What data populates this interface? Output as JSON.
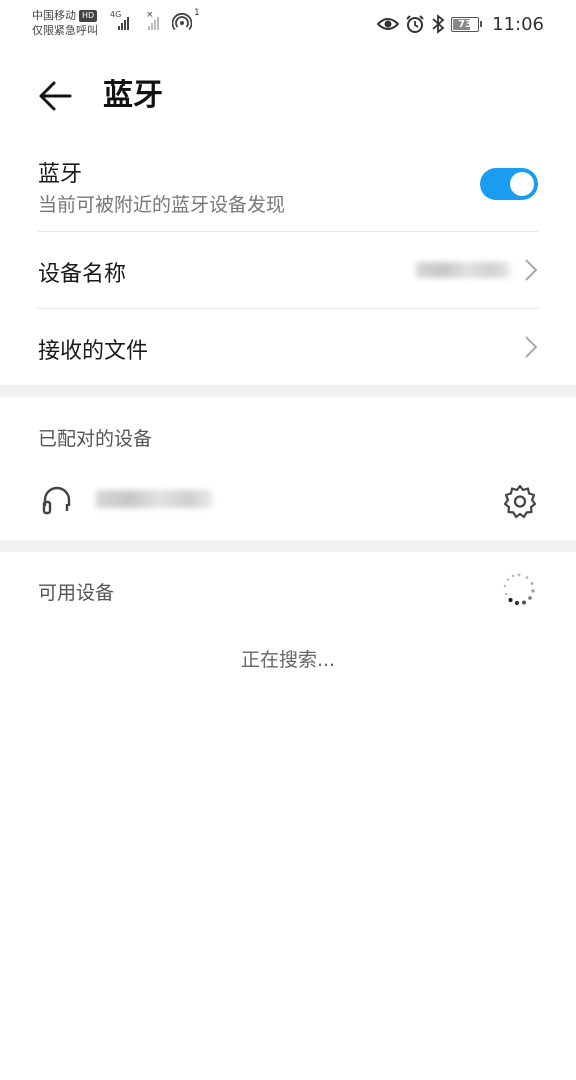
{
  "status_bar": {
    "carrier_line1": "中国移动",
    "hd_badge": "HD",
    "carrier_line2": "仅限紧急呼叫",
    "network_type": "4G",
    "hotspot_count": "1",
    "battery_level": "73",
    "battery_fraction": 0.73,
    "time": "11:06",
    "icons": [
      "signal-icon",
      "no-sim-icon",
      "hotspot-icon",
      "eye-comfort-icon",
      "alarm-icon",
      "bluetooth-icon",
      "battery-icon"
    ]
  },
  "header": {
    "title": "蓝牙",
    "back_icon": "arrow-left-icon"
  },
  "bluetooth_toggle": {
    "title": "蓝牙",
    "subtitle": "当前可被附近的蓝牙设备发现",
    "enabled": true,
    "accent_color": "#1a9cf0"
  },
  "device_name": {
    "title": "设备名称"
  },
  "received_files": {
    "title": "接收的文件"
  },
  "paired_section": {
    "title": "已配对的设备",
    "device_icon": "headset-icon",
    "settings_icon": "gear-icon"
  },
  "available_section": {
    "title": "可用设备",
    "loading_icon": "spinner-icon",
    "searching_text": "正在搜索..."
  }
}
